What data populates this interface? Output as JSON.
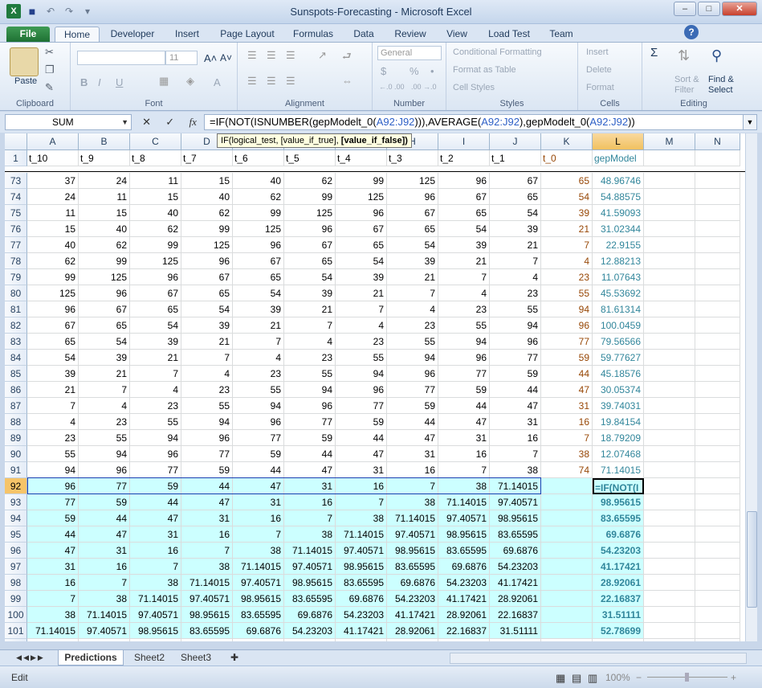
{
  "window": {
    "title": "Sunspots-Forecasting  -  Microsoft Excel",
    "minimize": "–",
    "maximize": "□",
    "close": "✕",
    "help": "?",
    "qat_undo": "↶",
    "qat_redo": "↷",
    "qat_more": "▾",
    "qat_excel_icon": "X",
    "qat_save": "■"
  },
  "tabs": [
    "File",
    "Home",
    "Developer",
    "Insert",
    "Page Layout",
    "Formulas",
    "Data",
    "Review",
    "View",
    "Load Test",
    "Team"
  ],
  "ribbon": {
    "clipboard": {
      "label": "Clipboard",
      "paste": "Paste"
    },
    "font": {
      "label": "Font",
      "size": "11",
      "bold": "B",
      "italic": "I",
      "underline": "U",
      "grow": "A˄",
      "shrink": "A˅",
      "color": "A"
    },
    "alignment": {
      "label": "Alignment"
    },
    "number": {
      "label": "Number",
      "format": "General",
      "currency": "$",
      "percent": "%",
      "comma": "•",
      "inc": "←.0 .00",
      "dec": ".00 →.0"
    },
    "styles": {
      "label": "Styles",
      "conditional": "Conditional Formatting",
      "table": "Format as Table",
      "cell": "Cell Styles"
    },
    "cells": {
      "label": "Cells",
      "insert": "Insert",
      "delete": "Delete",
      "format": "Format"
    },
    "editing": {
      "label": "Editing",
      "sum": "Σ",
      "sort": "Sort &",
      "filter": "Filter",
      "find": "Find &",
      "select": "Select"
    }
  },
  "formula_bar": {
    "name_box": "SUM",
    "cancel": "✕",
    "enter": "✓",
    "fx": "fx",
    "parts": [
      {
        "t": "=IF(NOT(ISNUMBER(gepModelt_0(",
        "c": ""
      },
      {
        "t": "A92:J92",
        "c": "ref"
      },
      {
        "t": "))),AVERAGE(",
        "c": ""
      },
      {
        "t": "A92:J92",
        "c": "ref"
      },
      {
        "t": "),gepModelt_0(",
        "c": ""
      },
      {
        "t": "A92:J92",
        "c": "ref"
      },
      {
        "t": "))",
        "c": ""
      }
    ],
    "tooltip_plain": "IF(logical_test, [value_if_true], ",
    "tooltip_bold": "[value_if_false])"
  },
  "columns": [
    "A",
    "B",
    "C",
    "D",
    "E",
    "F",
    "G",
    "H",
    "I",
    "J",
    "K",
    "L",
    "M",
    "N"
  ],
  "header_row": {
    "num": "1",
    "cells": [
      "t_10",
      "t_9",
      "t_8",
      "t_7",
      "t_6",
      "t_5",
      "t_4",
      "t_3",
      "t_2",
      "t_1",
      "t_0",
      "gepModel",
      "",
      ""
    ]
  },
  "rows": [
    {
      "n": "73",
      "c": [
        "37",
        "24",
        "11",
        "15",
        "40",
        "62",
        "99",
        "125",
        "96",
        "67",
        "65",
        "48.96746"
      ]
    },
    {
      "n": "74",
      "c": [
        "24",
        "11",
        "15",
        "40",
        "62",
        "99",
        "125",
        "96",
        "67",
        "65",
        "54",
        "54.88575"
      ]
    },
    {
      "n": "75",
      "c": [
        "11",
        "15",
        "40",
        "62",
        "99",
        "125",
        "96",
        "67",
        "65",
        "54",
        "39",
        "41.59093"
      ]
    },
    {
      "n": "76",
      "c": [
        "15",
        "40",
        "62",
        "99",
        "125",
        "96",
        "67",
        "65",
        "54",
        "39",
        "21",
        "31.02344"
      ]
    },
    {
      "n": "77",
      "c": [
        "40",
        "62",
        "99",
        "125",
        "96",
        "67",
        "65",
        "54",
        "39",
        "21",
        "7",
        "22.9155"
      ]
    },
    {
      "n": "78",
      "c": [
        "62",
        "99",
        "125",
        "96",
        "67",
        "65",
        "54",
        "39",
        "21",
        "7",
        "4",
        "12.88213"
      ]
    },
    {
      "n": "79",
      "c": [
        "99",
        "125",
        "96",
        "67",
        "65",
        "54",
        "39",
        "21",
        "7",
        "4",
        "23",
        "11.07643"
      ]
    },
    {
      "n": "80",
      "c": [
        "125",
        "96",
        "67",
        "65",
        "54",
        "39",
        "21",
        "7",
        "4",
        "23",
        "55",
        "45.53692"
      ]
    },
    {
      "n": "81",
      "c": [
        "96",
        "67",
        "65",
        "54",
        "39",
        "21",
        "7",
        "4",
        "23",
        "55",
        "94",
        "81.61314"
      ]
    },
    {
      "n": "82",
      "c": [
        "67",
        "65",
        "54",
        "39",
        "21",
        "7",
        "4",
        "23",
        "55",
        "94",
        "96",
        "100.0459"
      ]
    },
    {
      "n": "83",
      "c": [
        "65",
        "54",
        "39",
        "21",
        "7",
        "4",
        "23",
        "55",
        "94",
        "96",
        "77",
        "79.56566"
      ]
    },
    {
      "n": "84",
      "c": [
        "54",
        "39",
        "21",
        "7",
        "4",
        "23",
        "55",
        "94",
        "96",
        "77",
        "59",
        "59.77627"
      ]
    },
    {
      "n": "85",
      "c": [
        "39",
        "21",
        "7",
        "4",
        "23",
        "55",
        "94",
        "96",
        "77",
        "59",
        "44",
        "45.18576"
      ]
    },
    {
      "n": "86",
      "c": [
        "21",
        "7",
        "4",
        "23",
        "55",
        "94",
        "96",
        "77",
        "59",
        "44",
        "47",
        "30.05374"
      ]
    },
    {
      "n": "87",
      "c": [
        "7",
        "4",
        "23",
        "55",
        "94",
        "96",
        "77",
        "59",
        "44",
        "47",
        "31",
        "39.74031"
      ]
    },
    {
      "n": "88",
      "c": [
        "4",
        "23",
        "55",
        "94",
        "96",
        "77",
        "59",
        "44",
        "47",
        "31",
        "16",
        "19.84154"
      ]
    },
    {
      "n": "89",
      "c": [
        "23",
        "55",
        "94",
        "96",
        "77",
        "59",
        "44",
        "47",
        "31",
        "16",
        "7",
        "18.79209"
      ]
    },
    {
      "n": "90",
      "c": [
        "55",
        "94",
        "96",
        "77",
        "59",
        "44",
        "47",
        "31",
        "16",
        "7",
        "38",
        "12.07468"
      ]
    },
    {
      "n": "91",
      "c": [
        "94",
        "96",
        "77",
        "59",
        "44",
        "47",
        "31",
        "16",
        "7",
        "38",
        "74",
        "71.14015"
      ]
    },
    {
      "n": "92",
      "c": [
        "96",
        "77",
        "59",
        "44",
        "47",
        "31",
        "16",
        "7",
        "38",
        "71.14015",
        "",
        "=IF(NOT(I"
      ]
    },
    {
      "n": "93",
      "c": [
        "77",
        "59",
        "44",
        "47",
        "31",
        "16",
        "7",
        "38",
        "71.14015",
        "97.40571",
        "",
        "98.95615"
      ]
    },
    {
      "n": "94",
      "c": [
        "59",
        "44",
        "47",
        "31",
        "16",
        "7",
        "38",
        "71.14015",
        "97.40571",
        "98.95615",
        "",
        "83.65595"
      ]
    },
    {
      "n": "95",
      "c": [
        "44",
        "47",
        "31",
        "16",
        "7",
        "38",
        "71.14015",
        "97.40571",
        "98.95615",
        "83.65595",
        "",
        "69.6876"
      ]
    },
    {
      "n": "96",
      "c": [
        "47",
        "31",
        "16",
        "7",
        "38",
        "71.14015",
        "97.40571",
        "98.95615",
        "83.65595",
        "69.6876",
        "",
        "54.23203"
      ]
    },
    {
      "n": "97",
      "c": [
        "31",
        "16",
        "7",
        "38",
        "71.14015",
        "97.40571",
        "98.95615",
        "83.65595",
        "69.6876",
        "54.23203",
        "",
        "41.17421"
      ]
    },
    {
      "n": "98",
      "c": [
        "16",
        "7",
        "38",
        "71.14015",
        "97.40571",
        "98.95615",
        "83.65595",
        "69.6876",
        "54.23203",
        "41.17421",
        "",
        "28.92061"
      ]
    },
    {
      "n": "99",
      "c": [
        "7",
        "38",
        "71.14015",
        "97.40571",
        "98.95615",
        "83.65595",
        "69.6876",
        "54.23203",
        "41.17421",
        "28.92061",
        "",
        "22.16837"
      ]
    },
    {
      "n": "100",
      "c": [
        "38",
        "71.14015",
        "97.40571",
        "98.95615",
        "83.65595",
        "69.6876",
        "54.23203",
        "41.17421",
        "28.92061",
        "22.16837",
        "",
        "31.51111"
      ]
    },
    {
      "n": "101",
      "c": [
        "71.14015",
        "97.40571",
        "98.95615",
        "83.65595",
        "69.6876",
        "54.23203",
        "41.17421",
        "28.92061",
        "22.16837",
        "31.51111",
        "",
        "52.78699"
      ]
    },
    {
      "n": "102",
      "c": [
        "",
        "",
        "",
        "",
        "",
        "",
        "",
        "",
        "",
        "",
        "",
        ""
      ]
    }
  ],
  "sheets": [
    "Predictions",
    "Sheet2",
    "Sheet3"
  ],
  "status": {
    "mode": "Edit",
    "zoom": "100%",
    "zoom_minus": "−",
    "zoom_plus": "+"
  },
  "colors": {
    "accent": "#1f7a3e",
    "selection_fill": "#ccffff",
    "k_col_text": "#974706",
    "l_col_text": "#31869b",
    "header_sel": "#f6c468"
  }
}
